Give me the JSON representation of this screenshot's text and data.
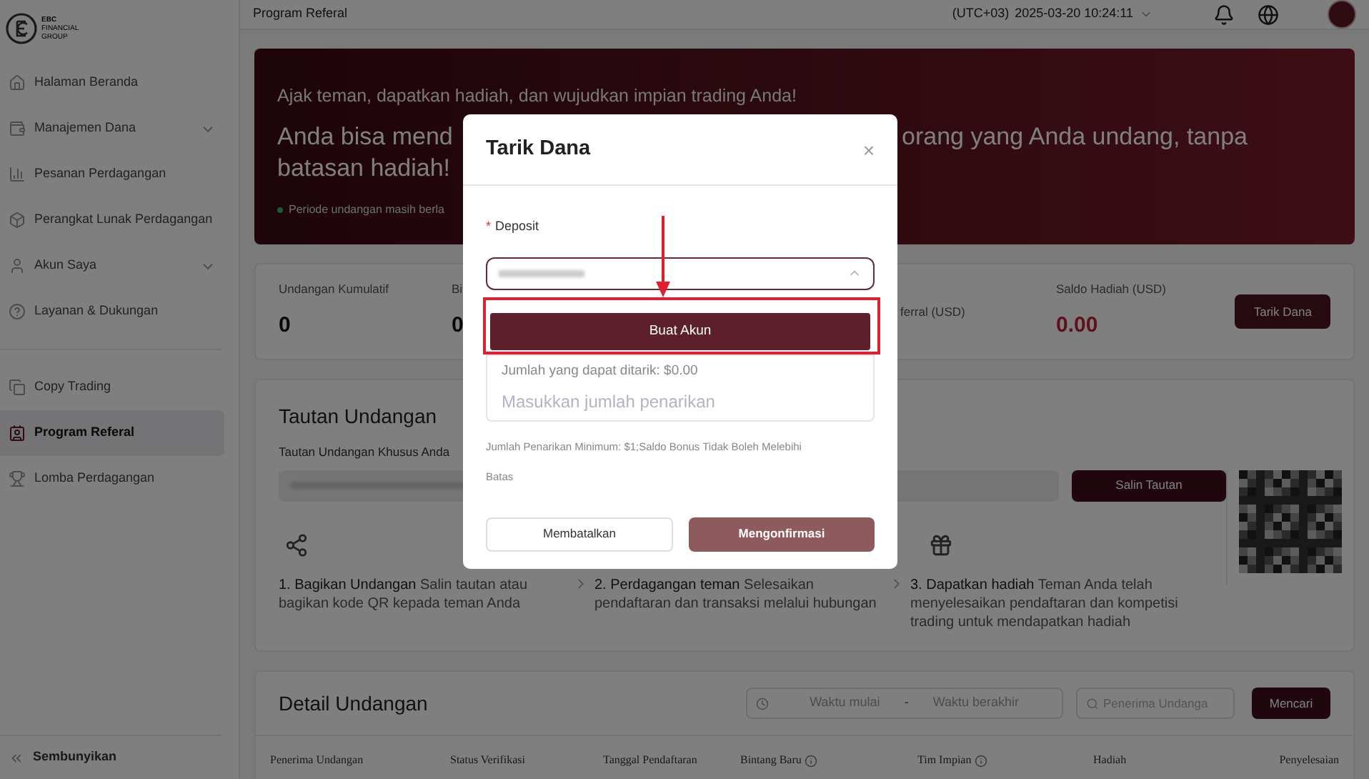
{
  "sidebar": {
    "logo": {
      "letters": "EBC",
      "line_1": "FINANCIAL",
      "line_2": "GROUP"
    },
    "items": [
      {
        "label": "Halaman Beranda",
        "kind": "home",
        "selected": false,
        "expandable": false
      },
      {
        "label": "Manajemen Dana",
        "kind": "wallet",
        "selected": false,
        "expandable": true
      },
      {
        "label": "Pesanan Perdagangan",
        "kind": "chart",
        "selected": false,
        "expandable": false
      },
      {
        "label": "Perangkat Lunak Perdagangan",
        "kind": "box",
        "selected": false,
        "expandable": false
      },
      {
        "label": "Akun Saya",
        "kind": "user",
        "selected": false,
        "expandable": true
      },
      {
        "label": "Layanan & Dukungan",
        "kind": "help",
        "selected": false,
        "expandable": false
      }
    ],
    "items_2": [
      {
        "label": "Copy Trading",
        "kind": "copy",
        "selected": false,
        "expandable": false
      },
      {
        "label": "Program Referal",
        "kind": "badge",
        "selected": true,
        "expandable": false
      },
      {
        "label": "Lomba Perdagangan",
        "kind": "trophy",
        "selected": false,
        "expandable": false
      }
    ],
    "collapse": "Sembunyikan"
  },
  "header": {
    "title": "Program Referal",
    "timezone": "(UTC+03)",
    "datetime": "2025-03-20 10:24:11"
  },
  "banner": {
    "tagline": "Ajak teman, dapatkan hadiah, dan wujudkan impian trading Anda!",
    "headline_left": "Anda bisa mend",
    "headline_right": "orang yang Anda undang, tanpa",
    "headline_line_2": "batasan hadiah!",
    "period": "Periode undangan masih berla"
  },
  "stats": [
    {
      "label": "Undangan Kumulatif",
      "value": "0",
      "kind": "count"
    },
    {
      "label": "Bi",
      "value": "0",
      "kind": "count"
    },
    {
      "label": "ferral (USD)"
    },
    {
      "label": "Saldo Hadiah (USD)",
      "value": "0.00",
      "kind": "balance"
    }
  ],
  "withdraw_button": "Tarik Dana",
  "invite_link": {
    "title": "Tautan Undangan",
    "label": "Tautan Undangan Khusus Anda",
    "copy_button": "Salin Tautan",
    "steps": [
      {
        "title": "1. Bagikan Undangan",
        "text": "Salin tautan atau bagikan kode QR kepada teman Anda"
      },
      {
        "title": "2. Perdagangan teman",
        "text": "Selesaikan pendaftaran dan transaksi melalui hubungan"
      },
      {
        "title": "3. Dapatkan hadiah",
        "text": "Teman Anda telah menyelesaikan pendaftaran dan kompetisi trading untuk mendapatkan hadiah"
      }
    ]
  },
  "details": {
    "title": "Detail Undangan",
    "start_placeholder": "Waktu mulai",
    "separator": "-",
    "end_placeholder": "Waktu berakhir",
    "search_placeholder": "Penerima Undanga",
    "search_button": "Mencari",
    "columns": [
      {
        "label": "Penerima Undangan",
        "info": false
      },
      {
        "label": "Status Verifikasi",
        "info": false
      },
      {
        "label": "Tanggal Pendaftaran",
        "info": false
      },
      {
        "label": "Bintang Baru",
        "info": true
      },
      {
        "label": "Tim Impian",
        "info": true
      },
      {
        "label": "Hadiah",
        "info": false
      },
      {
        "label": "Penyelesaian",
        "info": false
      }
    ]
  },
  "dialog": {
    "title": "Tarik Dana",
    "close": "×",
    "required_mark": "*",
    "field_label": "Deposit",
    "highlighted_button": "Buat Akun",
    "available": "Jumlah yang dapat ditarik: $0.00",
    "amount_placeholder": "Masukkan jumlah penarikan",
    "hint": "Jumlah Penarikan Minimum: $1;Saldo Bonus Tidak Boleh Melebihi Batas",
    "cancel": "Membatalkan",
    "confirm": "Mengonfirmasi"
  }
}
